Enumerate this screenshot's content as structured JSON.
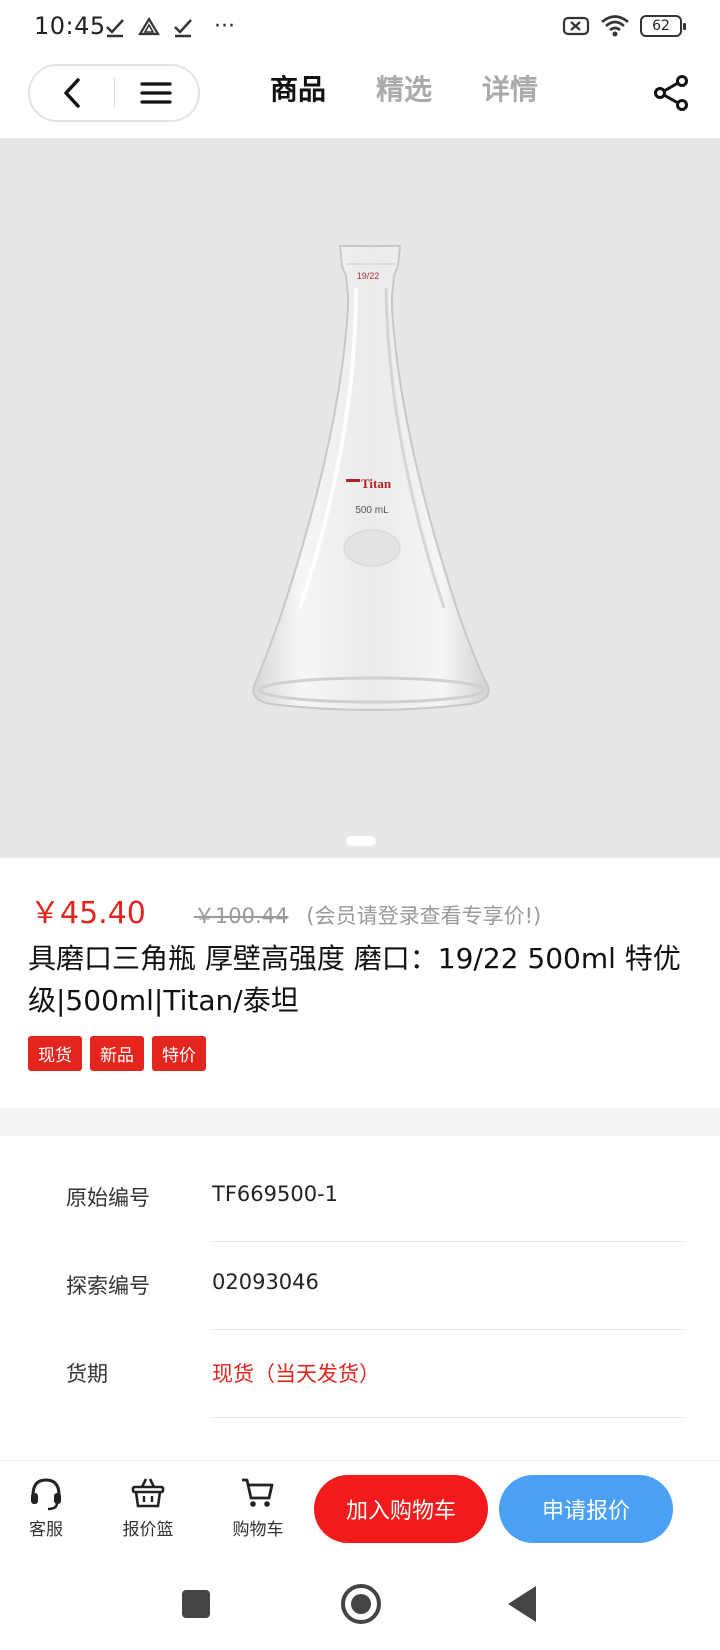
{
  "status_bar": {
    "time": "10:45",
    "more": "···",
    "battery": "62"
  },
  "nav": {
    "tabs": [
      "商品",
      "精选",
      "详情"
    ]
  },
  "product": {
    "image": {
      "joint_label": "19/22",
      "brand_label": "Titan",
      "volume_label": "500 mL"
    },
    "price": "￥45.40",
    "original_price": "￥100.44",
    "member_note": "(会员请登录查看专享价!)",
    "title": "具磨口三角瓶 厚壁高强度 磨口：19/22 500ml 特优级|500ml|Titan/泰坦",
    "tags": [
      "现货",
      "新品",
      "特价"
    ]
  },
  "specs": [
    {
      "label": "原始编号",
      "value": "TF669500-1"
    },
    {
      "label": "探索编号",
      "value": "02093046"
    },
    {
      "label": "货期",
      "value": "现货（当天发货）"
    }
  ],
  "bottom_bar": {
    "service": "客服",
    "quote_basket": "报价篮",
    "cart": "购物车",
    "add_to_cart": "加入购物车",
    "request_quote": "申请报价"
  },
  "colors": {
    "accent_red": "#e3251d",
    "button_red": "#f21b1b",
    "button_blue": "#4aa0f5"
  }
}
